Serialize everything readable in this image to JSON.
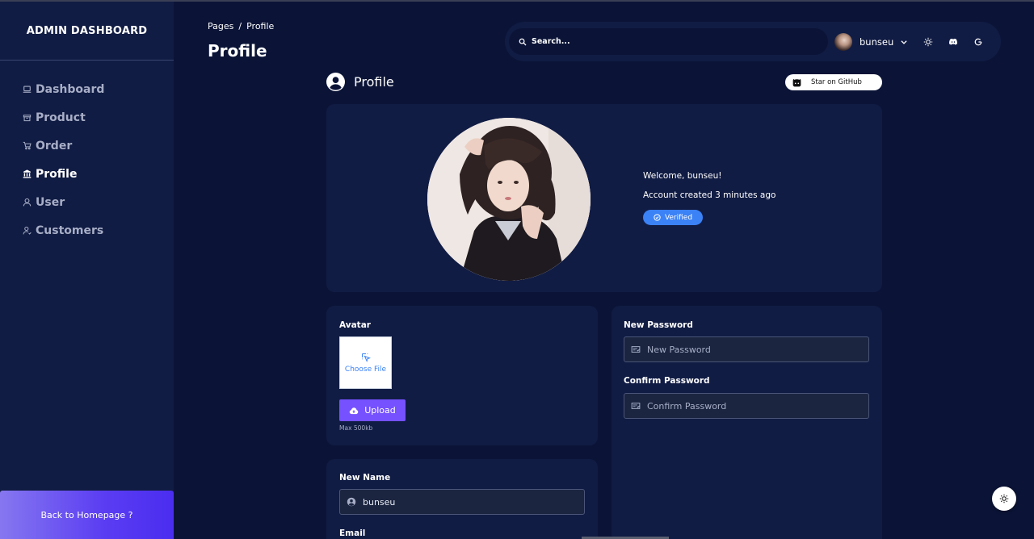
{
  "sidebar": {
    "brand": "ADMIN DASHBOARD",
    "items": [
      {
        "label": "Dashboard",
        "icon": "laptop-icon"
      },
      {
        "label": "Product",
        "icon": "box-icon"
      },
      {
        "label": "Order",
        "icon": "cart-icon"
      },
      {
        "label": "Profile",
        "icon": "building-icon",
        "active": true
      },
      {
        "label": "User",
        "icon": "user-icon"
      },
      {
        "label": "Customers",
        "icon": "person-icon"
      }
    ],
    "back_label": "Back to Homepage ?"
  },
  "header": {
    "breadcrumb": [
      "Pages",
      "Profile"
    ],
    "breadcrumb_sep": "/",
    "title": "Profile",
    "search_placeholder": "Search...",
    "username": "bunseu"
  },
  "section": {
    "title": "Profile",
    "github_button": "Star on GitHub"
  },
  "profile": {
    "welcome": "Welcome, bunseu!",
    "created": "Account created 3 minutes ago",
    "badge": "Verified"
  },
  "avatar_form": {
    "label": "Avatar",
    "choose_file": "Choose File",
    "upload": "Upload",
    "max_note": "Max 500kb"
  },
  "password_form": {
    "new_label": "New Password",
    "new_placeholder": "New Password",
    "confirm_label": "Confirm Password",
    "confirm_placeholder": "Confirm Password"
  },
  "name_form": {
    "name_label": "New Name",
    "name_value": "bunseu",
    "email_label": "Email"
  },
  "colors": {
    "background": "#0b1437",
    "panel": "#111c44",
    "accent": "#7551ff",
    "badge": "#3b82f6"
  }
}
